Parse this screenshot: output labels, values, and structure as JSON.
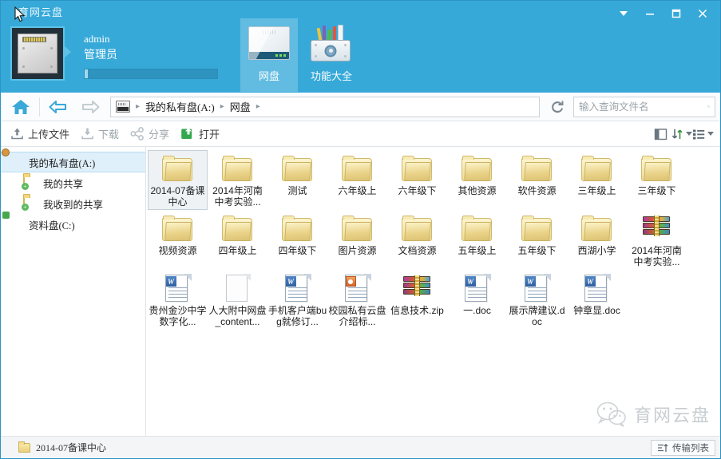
{
  "window": {
    "title": "育网云盘",
    "controls": [
      {
        "name": "menu-dropdown",
        "glyph": "▼"
      },
      {
        "name": "minimize",
        "glyph": "—"
      },
      {
        "name": "maximize",
        "glyph": "□"
      },
      {
        "name": "close",
        "glyph": "✕"
      }
    ]
  },
  "header": {
    "user": {
      "username": "admin",
      "role": "管理员",
      "avatar_icon": "disk-avatar-icon",
      "quota_percent": 2
    },
    "tabs": [
      {
        "label": "网盘",
        "icon": "network-disk-icon",
        "active": true
      },
      {
        "label": "功能大全",
        "icon": "toolbox-icon",
        "active": false
      }
    ],
    "accent_color": "#36a9d9"
  },
  "navbar": {
    "home_icon": "home-icon",
    "back_icon": "back-arrow-icon",
    "forward_icon": "forward-arrow-icon",
    "breadcrumb_icon": "computer-icon",
    "breadcrumb": [
      "我的私有盘(A:)",
      "网盘"
    ],
    "refresh_icon": "refresh-icon",
    "search": {
      "value": "",
      "placeholder": "输入查询文件名",
      "icon": "search-icon"
    }
  },
  "toolbar": {
    "actions": [
      {
        "label": "上传文件",
        "icon": "upload-icon",
        "state": "enabled"
      },
      {
        "label": "下载",
        "icon": "download-icon",
        "state": "disabled"
      },
      {
        "label": "分享",
        "icon": "share-icon",
        "state": "disabled"
      },
      {
        "label": "打开",
        "icon": "open-icon",
        "state": "enabled"
      }
    ],
    "view_buttons": [
      {
        "name": "preview-pane-icon"
      },
      {
        "name": "sort-icon"
      },
      {
        "name": "view-list-icon"
      }
    ]
  },
  "sidebar": {
    "items": [
      {
        "label": "我的私有盘(A:)",
        "icon": "private-disk-icon",
        "selected": true,
        "indent": false
      },
      {
        "label": "我的共享",
        "icon": "share-folder-icon",
        "selected": false,
        "indent": true
      },
      {
        "label": "我收到的共享",
        "icon": "share-folder-icon",
        "selected": false,
        "indent": true
      },
      {
        "label": "资料盘(C:)",
        "icon": "data-disk-icon",
        "selected": false,
        "indent": false
      }
    ]
  },
  "files": [
    {
      "name": "2014-07备课中心",
      "type": "folder",
      "selected": true
    },
    {
      "name": "2014年河南中考实验...",
      "type": "folder",
      "selected": false
    },
    {
      "name": "测试",
      "type": "folder",
      "selected": false
    },
    {
      "name": "六年级上",
      "type": "folder",
      "selected": false
    },
    {
      "name": "六年级下",
      "type": "folder",
      "selected": false
    },
    {
      "name": "其他资源",
      "type": "folder",
      "selected": false
    },
    {
      "name": "软件资源",
      "type": "folder",
      "selected": false
    },
    {
      "name": "三年级上",
      "type": "folder",
      "selected": false
    },
    {
      "name": "三年级下",
      "type": "folder",
      "selected": false
    },
    {
      "name": "视频资源",
      "type": "folder",
      "selected": false
    },
    {
      "name": "四年级上",
      "type": "folder",
      "selected": false
    },
    {
      "name": "四年级下",
      "type": "folder",
      "selected": false
    },
    {
      "name": "图片资源",
      "type": "folder",
      "selected": false
    },
    {
      "name": "文档资源",
      "type": "folder",
      "selected": false
    },
    {
      "name": "五年级上",
      "type": "folder",
      "selected": false
    },
    {
      "name": "五年级下",
      "type": "folder",
      "selected": false
    },
    {
      "name": "西湖小学",
      "type": "folder",
      "selected": false
    },
    {
      "name": "2014年河南中考实验...",
      "type": "rar",
      "selected": false
    },
    {
      "name": "贵州金沙中学数字化...",
      "type": "doc",
      "selected": false
    },
    {
      "name": "人大附中网盘_content...",
      "type": "blank",
      "selected": false
    },
    {
      "name": "手机客户端bug就修订...",
      "type": "doc",
      "selected": false
    },
    {
      "name": "校园私有云盘介绍标...",
      "type": "ppt",
      "selected": false
    },
    {
      "name": "信息技术.zip",
      "type": "rar",
      "selected": false
    },
    {
      "name": "一.doc",
      "type": "doc",
      "selected": false
    },
    {
      "name": "展示牌建议.doc",
      "type": "doc",
      "selected": false
    },
    {
      "name": "钟章显.doc",
      "type": "doc",
      "selected": false
    }
  ],
  "watermark": {
    "text": "育网云盘",
    "icon": "wechat-icon"
  },
  "statusbar": {
    "selected_item": "2014-07备课中心",
    "folder_icon": "folder-icon",
    "transfer": {
      "label": "传输列表",
      "icon": "transfer-icon"
    }
  }
}
